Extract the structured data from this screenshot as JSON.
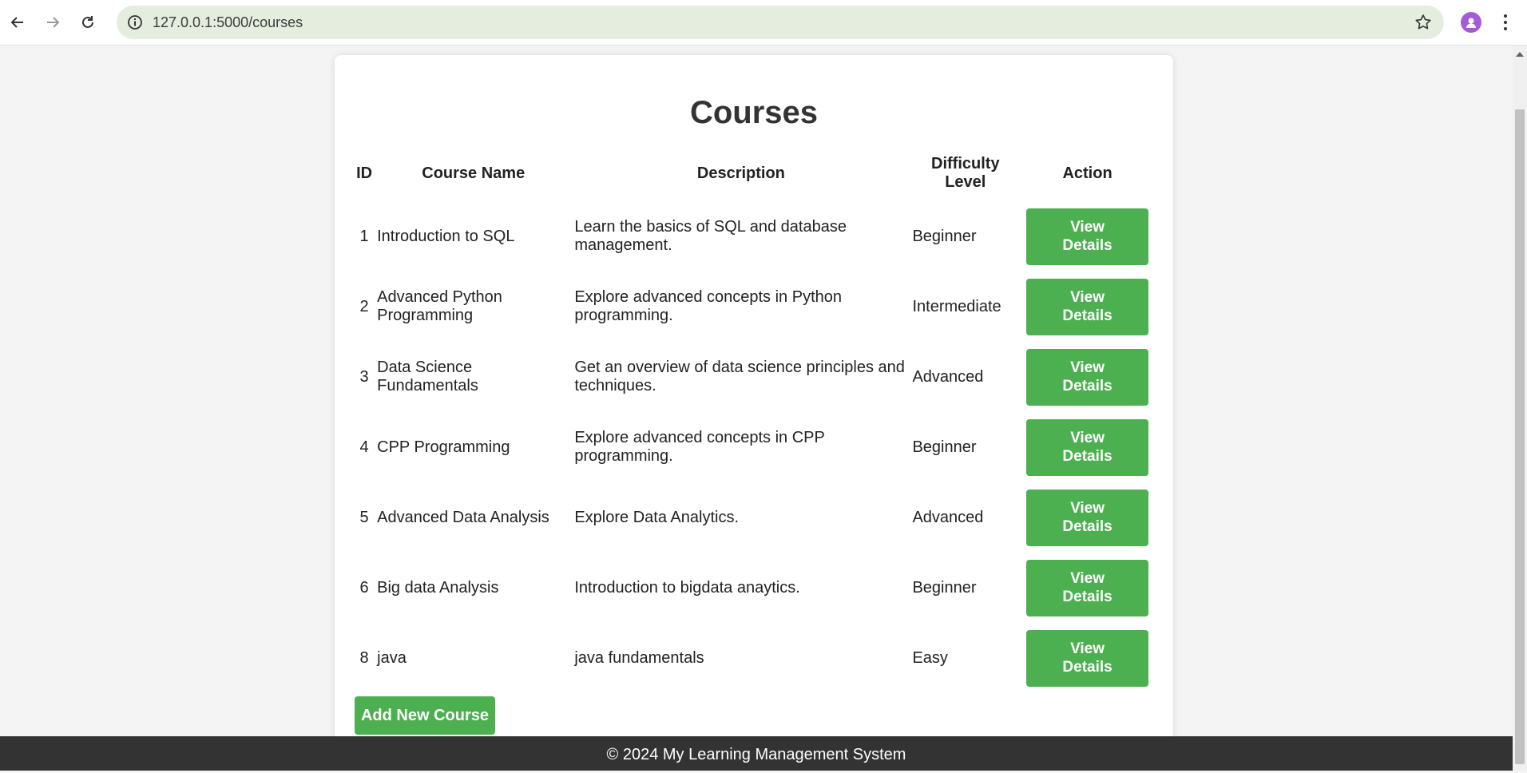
{
  "browser": {
    "url": "127.0.0.1:5000/courses"
  },
  "page": {
    "title": "Courses",
    "columns": {
      "id": "ID",
      "name": "Course Name",
      "description": "Description",
      "level": "Difficulty\nLevel",
      "action": "Action"
    },
    "courses": [
      {
        "id": "1",
        "name": "Introduction to SQL",
        "description": "Learn the basics of SQL and database management.",
        "level": "Beginner",
        "action": "View\nDetails"
      },
      {
        "id": "2",
        "name": "Advanced Python Programming",
        "description": "Explore advanced concepts in Python programming.",
        "level": "Intermediate",
        "action": "View\nDetails"
      },
      {
        "id": "3",
        "name": "Data Science Fundamentals",
        "description": "Get an overview of data science principles and techniques.",
        "level": "Advanced",
        "action": "View\nDetails"
      },
      {
        "id": "4",
        "name": "CPP Programming",
        "description": "Explore advanced concepts in CPP programming.",
        "level": "Beginner",
        "action": "View\nDetails"
      },
      {
        "id": "5",
        "name": "Advanced Data Analysis",
        "description": "Explore Data Analytics.",
        "level": "Advanced",
        "action": "View\nDetails"
      },
      {
        "id": "6",
        "name": "Big data Analysis",
        "description": "Introduction to bigdata anaytics.",
        "level": "Beginner",
        "action": "View\nDetails"
      },
      {
        "id": "8",
        "name": "java",
        "description": "java fundamentals",
        "level": "Easy",
        "action": "View\nDetails"
      }
    ],
    "add_button": "Add New Course"
  },
  "footer": {
    "text": "© 2024 My Learning Management System"
  },
  "colors": {
    "accent_green": "#4caf50",
    "footer_bg": "#333333"
  }
}
